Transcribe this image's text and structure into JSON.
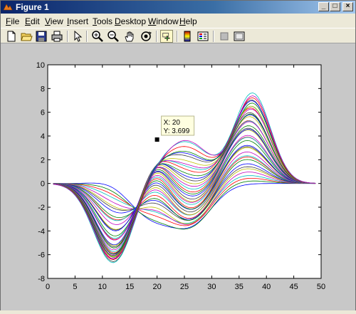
{
  "window": {
    "title": "Figure 1",
    "buttons": {
      "minimize": "_",
      "maximize": "□",
      "close": "×"
    }
  },
  "menubar": {
    "items": [
      {
        "label": "File",
        "key": "F",
        "rest": "ile"
      },
      {
        "label": "Edit",
        "key": "E",
        "rest": "dit"
      },
      {
        "label": "View",
        "key": "V",
        "rest": "iew"
      },
      {
        "label": "Insert",
        "key": "I",
        "rest": "nsert"
      },
      {
        "label": "Tools",
        "key": "T",
        "rest": "ools"
      },
      {
        "label": "Desktop",
        "key": "D",
        "rest": "esktop"
      },
      {
        "label": "Window",
        "key": "W",
        "rest": "indow"
      },
      {
        "label": "Help",
        "key": "H",
        "rest": "elp"
      }
    ]
  },
  "toolbar": {
    "tools": [
      "new-figure-icon",
      "open-file-icon",
      "save-icon",
      "print-icon",
      "edit-plot-arrow-icon",
      "zoom-in-icon",
      "zoom-out-icon",
      "pan-hand-icon",
      "rotate-3d-icon",
      "data-cursor-icon",
      "insert-colorbar-icon",
      "insert-legend-icon",
      "hide-plot-tools-icon",
      "show-plot-tools-icon"
    ]
  },
  "chart_data": {
    "type": "line",
    "title": "",
    "xlabel": "",
    "ylabel": "",
    "xlim": [
      0,
      50
    ],
    "ylim": [
      -8,
      10
    ],
    "xticks": [
      "0",
      "5",
      "10",
      "15",
      "20",
      "25",
      "30",
      "35",
      "40",
      "45",
      "50"
    ],
    "yticks": [
      "-8",
      "-6",
      "-4",
      "-2",
      "0",
      "2",
      "4",
      "6",
      "8",
      "10"
    ],
    "grid": false,
    "legend": "none",
    "series_count": 40,
    "series_colors": [
      "#0000ff",
      "#008000",
      "#ff0000",
      "#00bfbf",
      "#bf00bf",
      "#bfbf00",
      "#404040"
    ],
    "data_tip": {
      "x": 20,
      "y": 3.699,
      "line1": "X: 20",
      "line2": "Y: 3.699"
    },
    "series_envelope": {
      "x": [
        1,
        12,
        20,
        25,
        29,
        37.5,
        49
      ],
      "max_y": [
        -0.1,
        -6.5,
        3.9,
        3.6,
        0.6,
        8.1,
        0.1
      ],
      "min_y": [
        -0.1,
        0.3,
        -2.4,
        -3.0,
        -2.6,
        0.0,
        0.0
      ],
      "note": ""
    }
  }
}
